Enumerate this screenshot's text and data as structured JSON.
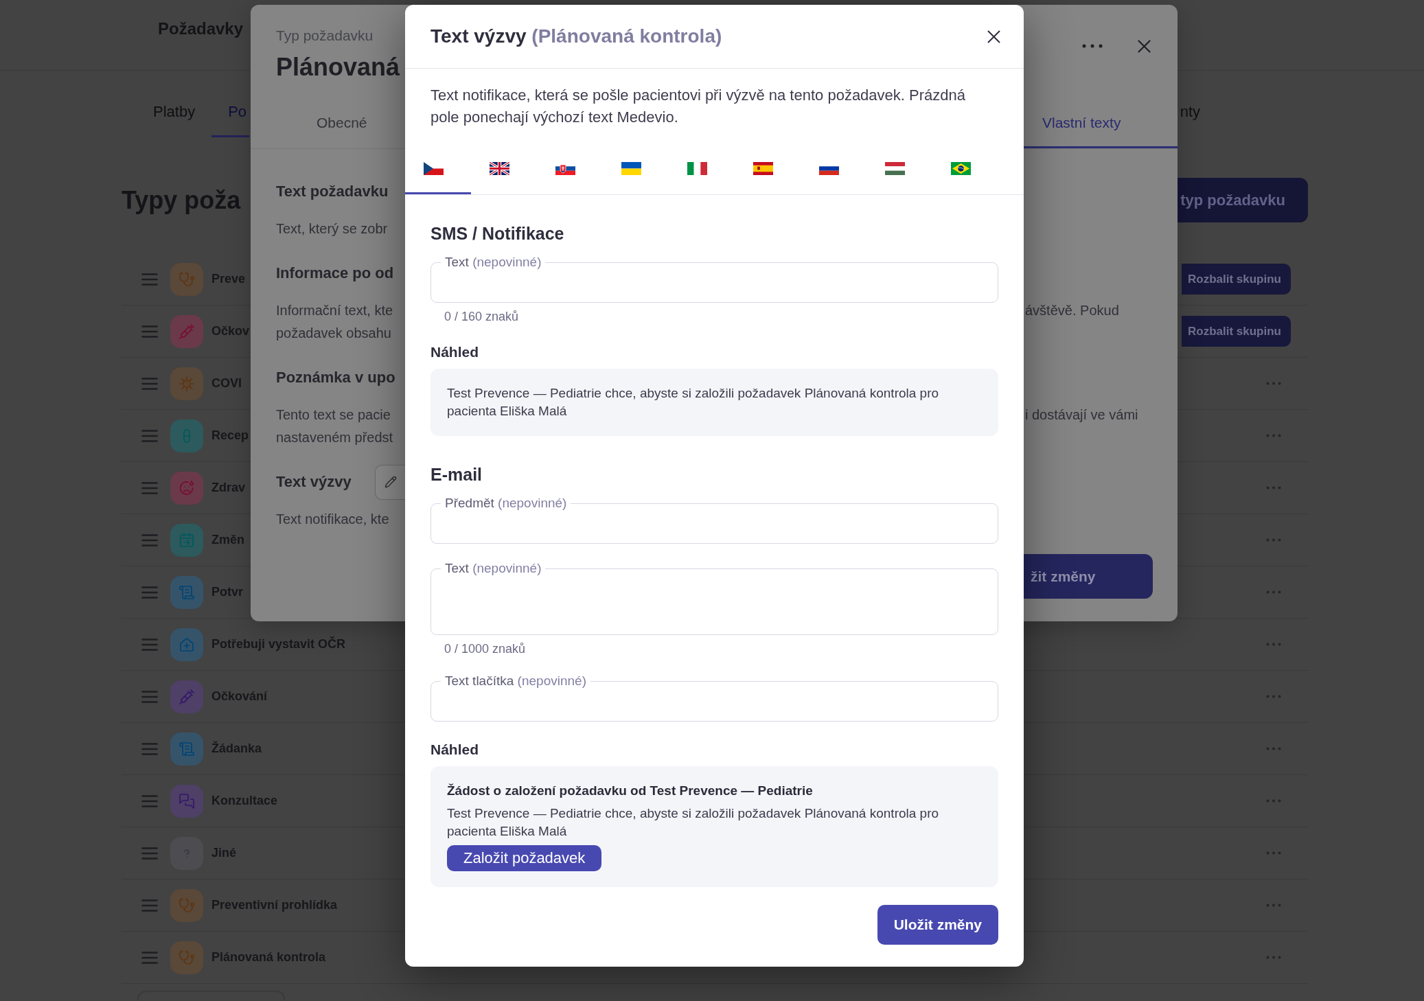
{
  "page": {
    "title": "Požadavky",
    "tabs": [
      {
        "label": "Platby",
        "selected": false
      },
      {
        "label": "Po",
        "selected": true
      },
      {
        "label": "nty",
        "selected": false
      }
    ],
    "heading": "Typy poža",
    "add_button": "typ požadavku",
    "request_types": [
      {
        "name": "Preve",
        "kind": "checkup",
        "color": "#5a4838",
        "expand_button": "Rozbalit skupinu"
      },
      {
        "name": "Očkov",
        "kind": "vaccination",
        "color": "#6a3a4a",
        "expand_button": "Rozbalit skupinu"
      },
      {
        "name": "COVI",
        "kind": "covid",
        "color": "#5a4838"
      },
      {
        "name": "Recep",
        "kind": "prescription",
        "color": "#2d5a5c"
      },
      {
        "name": "Zdrav",
        "kind": "illness",
        "color": "#6a3a4a"
      },
      {
        "name": "Změn",
        "kind": "reschedule",
        "color": "#2d5a5c"
      },
      {
        "name": "Potvr",
        "kind": "document",
        "color": "#35546a"
      },
      {
        "name": "Potřebuji vystavit OČR",
        "kind": "sickleave",
        "color": "#35546a"
      },
      {
        "name": "Očkování",
        "kind": "vaccination",
        "color": "#4e4066"
      },
      {
        "name": "Žádanka",
        "kind": "document",
        "color": "#35546a"
      },
      {
        "name": "Konzultace",
        "kind": "consultation",
        "color": "#4e4066"
      },
      {
        "name": "Jiné",
        "kind": "other",
        "color": "#4c4c51"
      },
      {
        "name": "Preventivní prohlídka",
        "kind": "checkup",
        "color": "#5a4838"
      },
      {
        "name": "Plánovaná kontrola",
        "kind": "checkup",
        "color": "#5a4838"
      }
    ]
  },
  "request_type_dialog": {
    "overline": "Typ požadavku",
    "title": "Plánovaná",
    "tabs": [
      {
        "label": "Obecné",
        "selected": false
      },
      {
        "label": "Vlastní texty",
        "selected": true
      }
    ],
    "sections": [
      {
        "heading": "Text požadavku",
        "editable": false,
        "lines": [
          {
            "left": "Text, který se zobr"
          }
        ]
      },
      {
        "heading": "Informace po od",
        "editable": false,
        "lines": [
          {
            "left": "Informační text, kte",
            "right": "ávštěvě. Pokud"
          },
          {
            "left": "požadavek obsahu"
          }
        ]
      },
      {
        "heading": "Poznámka v upo",
        "editable": false,
        "lines": [
          {
            "left": "Tento text se pacie",
            "right": "i dostávají ve vámi"
          },
          {
            "left": "nastaveném předst"
          }
        ]
      },
      {
        "heading": "Text výzvy",
        "editable": true,
        "lines": [
          {
            "left": "Text notifikace, kte"
          }
        ]
      }
    ],
    "save_button": "žit změny"
  },
  "custom_text_dialog": {
    "title": "Text výzvy",
    "subtitle": "(Plánovaná kontrola)",
    "description": "Text notifikace, která se pošle pacientovi při výzvě na tento požadavek. Prázdná pole ponechají výchozí text Medevio.",
    "languages": [
      {
        "kind": "cs",
        "selected": true
      },
      {
        "kind": "en",
        "selected": false
      },
      {
        "kind": "sk",
        "selected": false
      },
      {
        "kind": "uk",
        "selected": false
      },
      {
        "kind": "it",
        "selected": false
      },
      {
        "kind": "es",
        "selected": false
      },
      {
        "kind": "ru",
        "selected": false
      },
      {
        "kind": "hu",
        "selected": false
      },
      {
        "kind": "pt",
        "selected": false
      }
    ],
    "sections": [
      {
        "heading": "SMS / Notifikace",
        "fields": [
          {
            "label": "Text",
            "hint": "(nepovinné)",
            "multiline": false,
            "counter": "0 / 160 znaků"
          }
        ],
        "preview_heading": "Náhled",
        "preview": {
          "body": "Test Prevence — Pediatrie chce, abyste si založili požadavek Plánovaná kontrola pro pacienta Eliška Malá"
        }
      },
      {
        "heading": "E-mail",
        "fields": [
          {
            "label": "Předmět",
            "hint": "(nepovinné)",
            "multiline": false
          },
          {
            "label": "Text",
            "hint": "(nepovinné)",
            "multiline": true,
            "counter": "0 / 1000 znaků"
          },
          {
            "label": "Text tlačítka",
            "hint": "(nepovinné)",
            "multiline": false
          }
        ],
        "preview_heading": "Náhled",
        "preview": {
          "subject": "Žádost o založení požadavku od Test Prevence — Pediatrie",
          "body": "Test Prevence — Pediatrie chce, abyste si založili požadavek Plánovaná kontrola pro pacienta Eliška Malá",
          "button": "Založit požadavek"
        }
      }
    ],
    "save_button": "Uložit změny"
  }
}
